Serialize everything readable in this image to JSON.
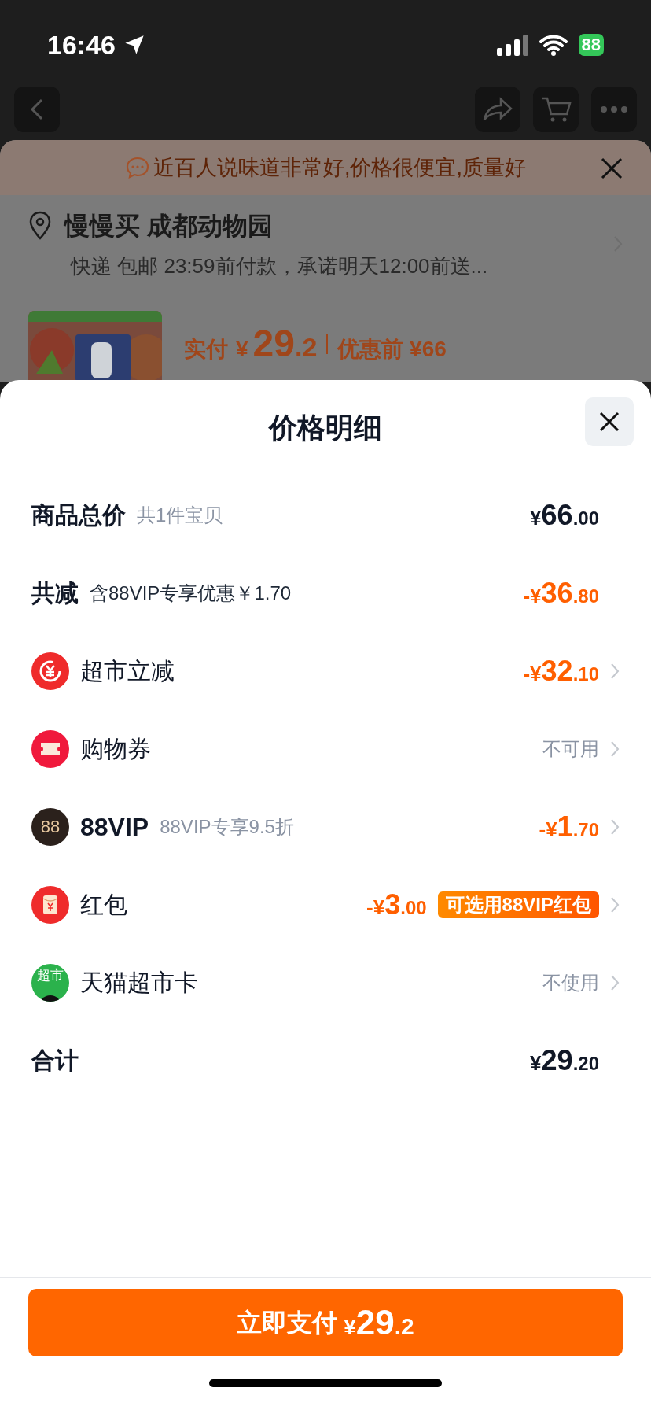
{
  "status_bar": {
    "time": "16:46",
    "battery": "88"
  },
  "background_page": {
    "banner": "近百人说味道非常好,价格很便宜,质量好",
    "address": {
      "title": "慢慢买 成都动物园",
      "detail": "快递 包邮 23:59前付款，承诺明天12:00前送..."
    },
    "price": {
      "paid_label": "实付",
      "currency": "¥",
      "integer": "29",
      "decimal": ".2",
      "before_label": "优惠前 ¥66"
    }
  },
  "sheet": {
    "title": "价格明细",
    "rows": [
      {
        "kind": "total",
        "label": "商品总价",
        "note": "共1件宝贝",
        "amount": {
          "prefix": "¥",
          "integer": "66",
          "decimal": ".00"
        },
        "chevron": false
      },
      {
        "kind": "saving",
        "label": "共减",
        "note": "含88VIP专享优惠￥1.70",
        "amount": {
          "prefix": "-¥",
          "integer": "36",
          "decimal": ".80"
        },
        "chevron": false
      },
      {
        "kind": "discount",
        "label": "超市立减",
        "amount": {
          "prefix": "-¥",
          "integer": "32",
          "decimal": ".10"
        },
        "chevron": true
      },
      {
        "kind": "coupon",
        "label": "购物券",
        "status": "不可用",
        "chevron": true
      },
      {
        "kind": "vip",
        "icon_text": "88",
        "label": "88VIP",
        "note": "88VIP专享9.5折",
        "amount": {
          "prefix": "-¥",
          "integer": "1",
          "decimal": ".70"
        },
        "chevron": true
      },
      {
        "kind": "envelope",
        "label": "红包",
        "amount": {
          "prefix": "-¥",
          "integer": "3",
          "decimal": ".00"
        },
        "tag": "可选用88VIP红包",
        "chevron": true
      },
      {
        "kind": "card",
        "icon_text": "超市",
        "label": "天猫超市卡",
        "status": "不使用",
        "chevron": true
      },
      {
        "kind": "total",
        "label": "合计",
        "amount": {
          "prefix": "¥",
          "integer": "29",
          "decimal": ".20"
        },
        "chevron": false
      }
    ],
    "pay_button": {
      "label": "立即支付",
      "prefix": "¥",
      "integer": "29",
      "decimal": ".2"
    }
  }
}
